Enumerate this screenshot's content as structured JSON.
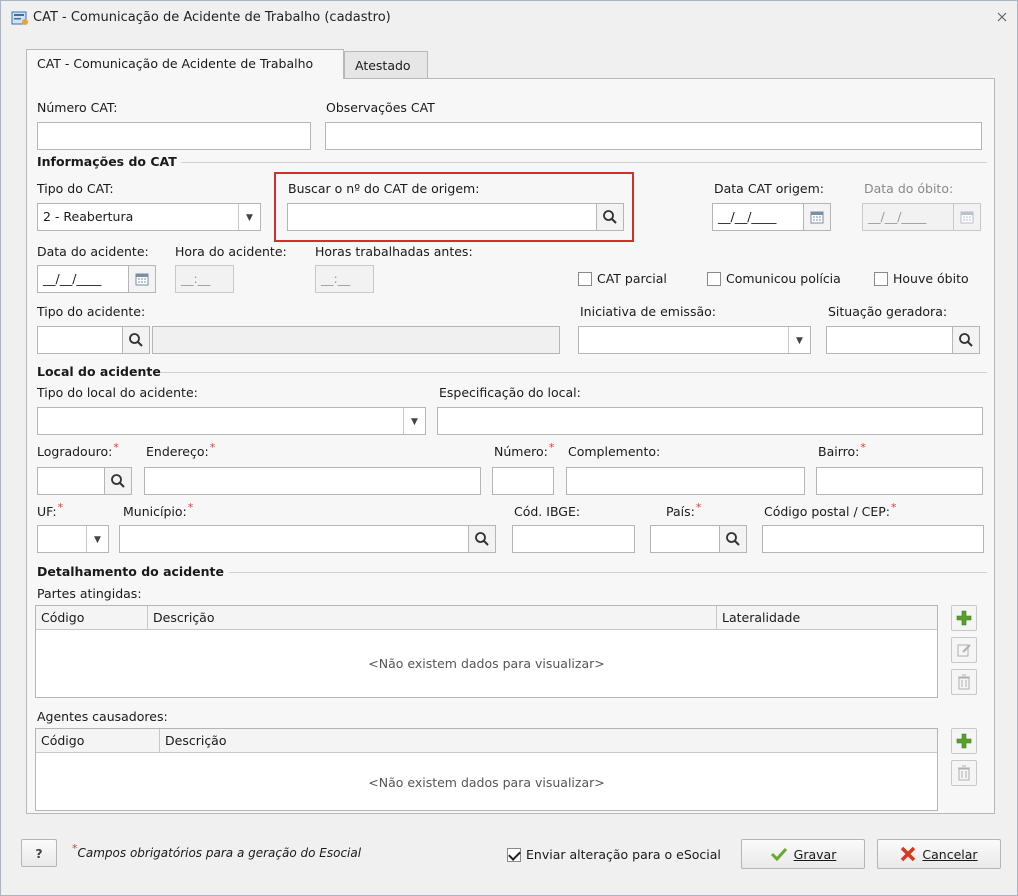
{
  "window": {
    "title": "CAT - Comunicação de Acidente de Trabalho (cadastro)",
    "close_icon": "close-icon"
  },
  "tabs": [
    {
      "label": "CAT - Comunicação de Acidente de Trabalho",
      "active": true
    },
    {
      "label": "Atestado",
      "active": false
    }
  ],
  "form": {
    "numero_cat_label": "Número CAT:",
    "observacoes_label": "Observações CAT",
    "info_section": "Informações do CAT",
    "tipo_cat_label": "Tipo do CAT:",
    "tipo_cat_value": "2 - Reabertura",
    "buscar_label": "Buscar o nº do CAT de origem:",
    "data_cat_origem_label": "Data CAT origem:",
    "data_cat_origem_value": "__/__/____",
    "data_obito_label": "Data do óbito:",
    "data_obito_value": "__/__/____",
    "data_acidente_label": "Data do acidente:",
    "data_acidente_value": "__/__/____",
    "hora_acidente_label": "Hora do acidente:",
    "hora_acidente_value": "__:__",
    "horas_trab_label": "Horas trabalhadas antes:",
    "horas_trab_value": "__:__",
    "cat_parcial_label": "CAT parcial",
    "comunicou_policia_label": "Comunicou polícia",
    "houve_obito_label": "Houve óbito",
    "tipo_acidente_label": "Tipo do acidente:",
    "iniciativa_label": "Iniciativa de emissão:",
    "situacao_label": "Situação geradora:",
    "local_section": "Local do acidente",
    "tipo_local_label": "Tipo do local do acidente:",
    "especificacao_label": "Especificação do local:",
    "logradouro_label": "Logradouro:",
    "endereco_label": "Endereço:",
    "numero_label": "Número:",
    "complemento_label": "Complemento:",
    "bairro_label": "Bairro:",
    "uf_label": "UF:",
    "municipio_label": "Município:",
    "cod_ibge_label": "Cód. IBGE:",
    "pais_label": "País:",
    "cep_label": "Código postal / CEP:",
    "required_mark": "*",
    "detalhamento_section": "Detalhamento do acidente",
    "partes_label": "Partes atingidas:",
    "partes_columns": [
      "Código",
      "Descrição",
      "Lateralidade"
    ],
    "partes_empty": "<Não existem dados para visualizar>",
    "agentes_label": "Agentes causadores:",
    "agentes_columns": [
      "Código",
      "Descrição"
    ],
    "agentes_empty": "<Não existem dados para visualizar>"
  },
  "footer": {
    "help_label": "?",
    "required_note": "Campos obrigatórios para a geração do Esocial",
    "required_mark": "*",
    "enviar_label": "Enviar alteração para o eSocial",
    "enviar_checked": true,
    "gravar_label": "Gravar",
    "cancelar_label": "Cancelar"
  },
  "colors": {
    "highlight": "#d32f2f",
    "required": "#e53935",
    "add_green": "#5aa02c",
    "cancel_red": "#d9381e"
  }
}
